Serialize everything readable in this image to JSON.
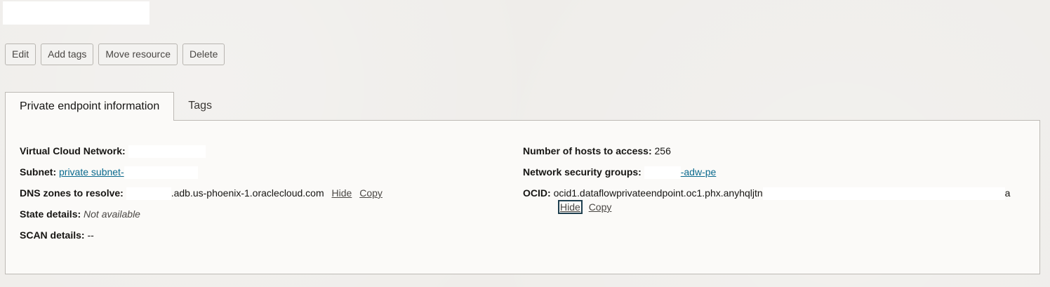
{
  "actions": {
    "edit": "Edit",
    "add_tags": "Add tags",
    "move_resource": "Move resource",
    "delete": "Delete"
  },
  "tabs": [
    {
      "label": "Private endpoint information",
      "active": true
    },
    {
      "label": "Tags",
      "active": false
    }
  ],
  "info": {
    "vcn_label": "Virtual Cloud Network:",
    "subnet_label": "Subnet:",
    "subnet_value": "private subnet-",
    "dns_label": "DNS zones to resolve:",
    "dns_value": ".adb.us-phoenix-1.oraclecloud.com",
    "dns_hide": "Hide",
    "dns_copy": "Copy",
    "state_label": "State details:",
    "state_value": "Not available",
    "scan_label": "SCAN details:",
    "scan_value": "--",
    "hosts_label": "Number of hosts to access:",
    "hosts_value": "256",
    "nsg_label": "Network security groups:",
    "nsg_value": "-adw-pe",
    "ocid_label": "OCID:",
    "ocid_value": "ocid1.dataflowprivateendpoint.oc1.phx.anyhqljtn",
    "ocid_tail": "a",
    "ocid_hide": "Hide",
    "ocid_copy": "Copy"
  },
  "colors": {
    "link": "#0b6a8e",
    "page_bg": "#efedea",
    "panel_bg": "#fbfaf8"
  }
}
